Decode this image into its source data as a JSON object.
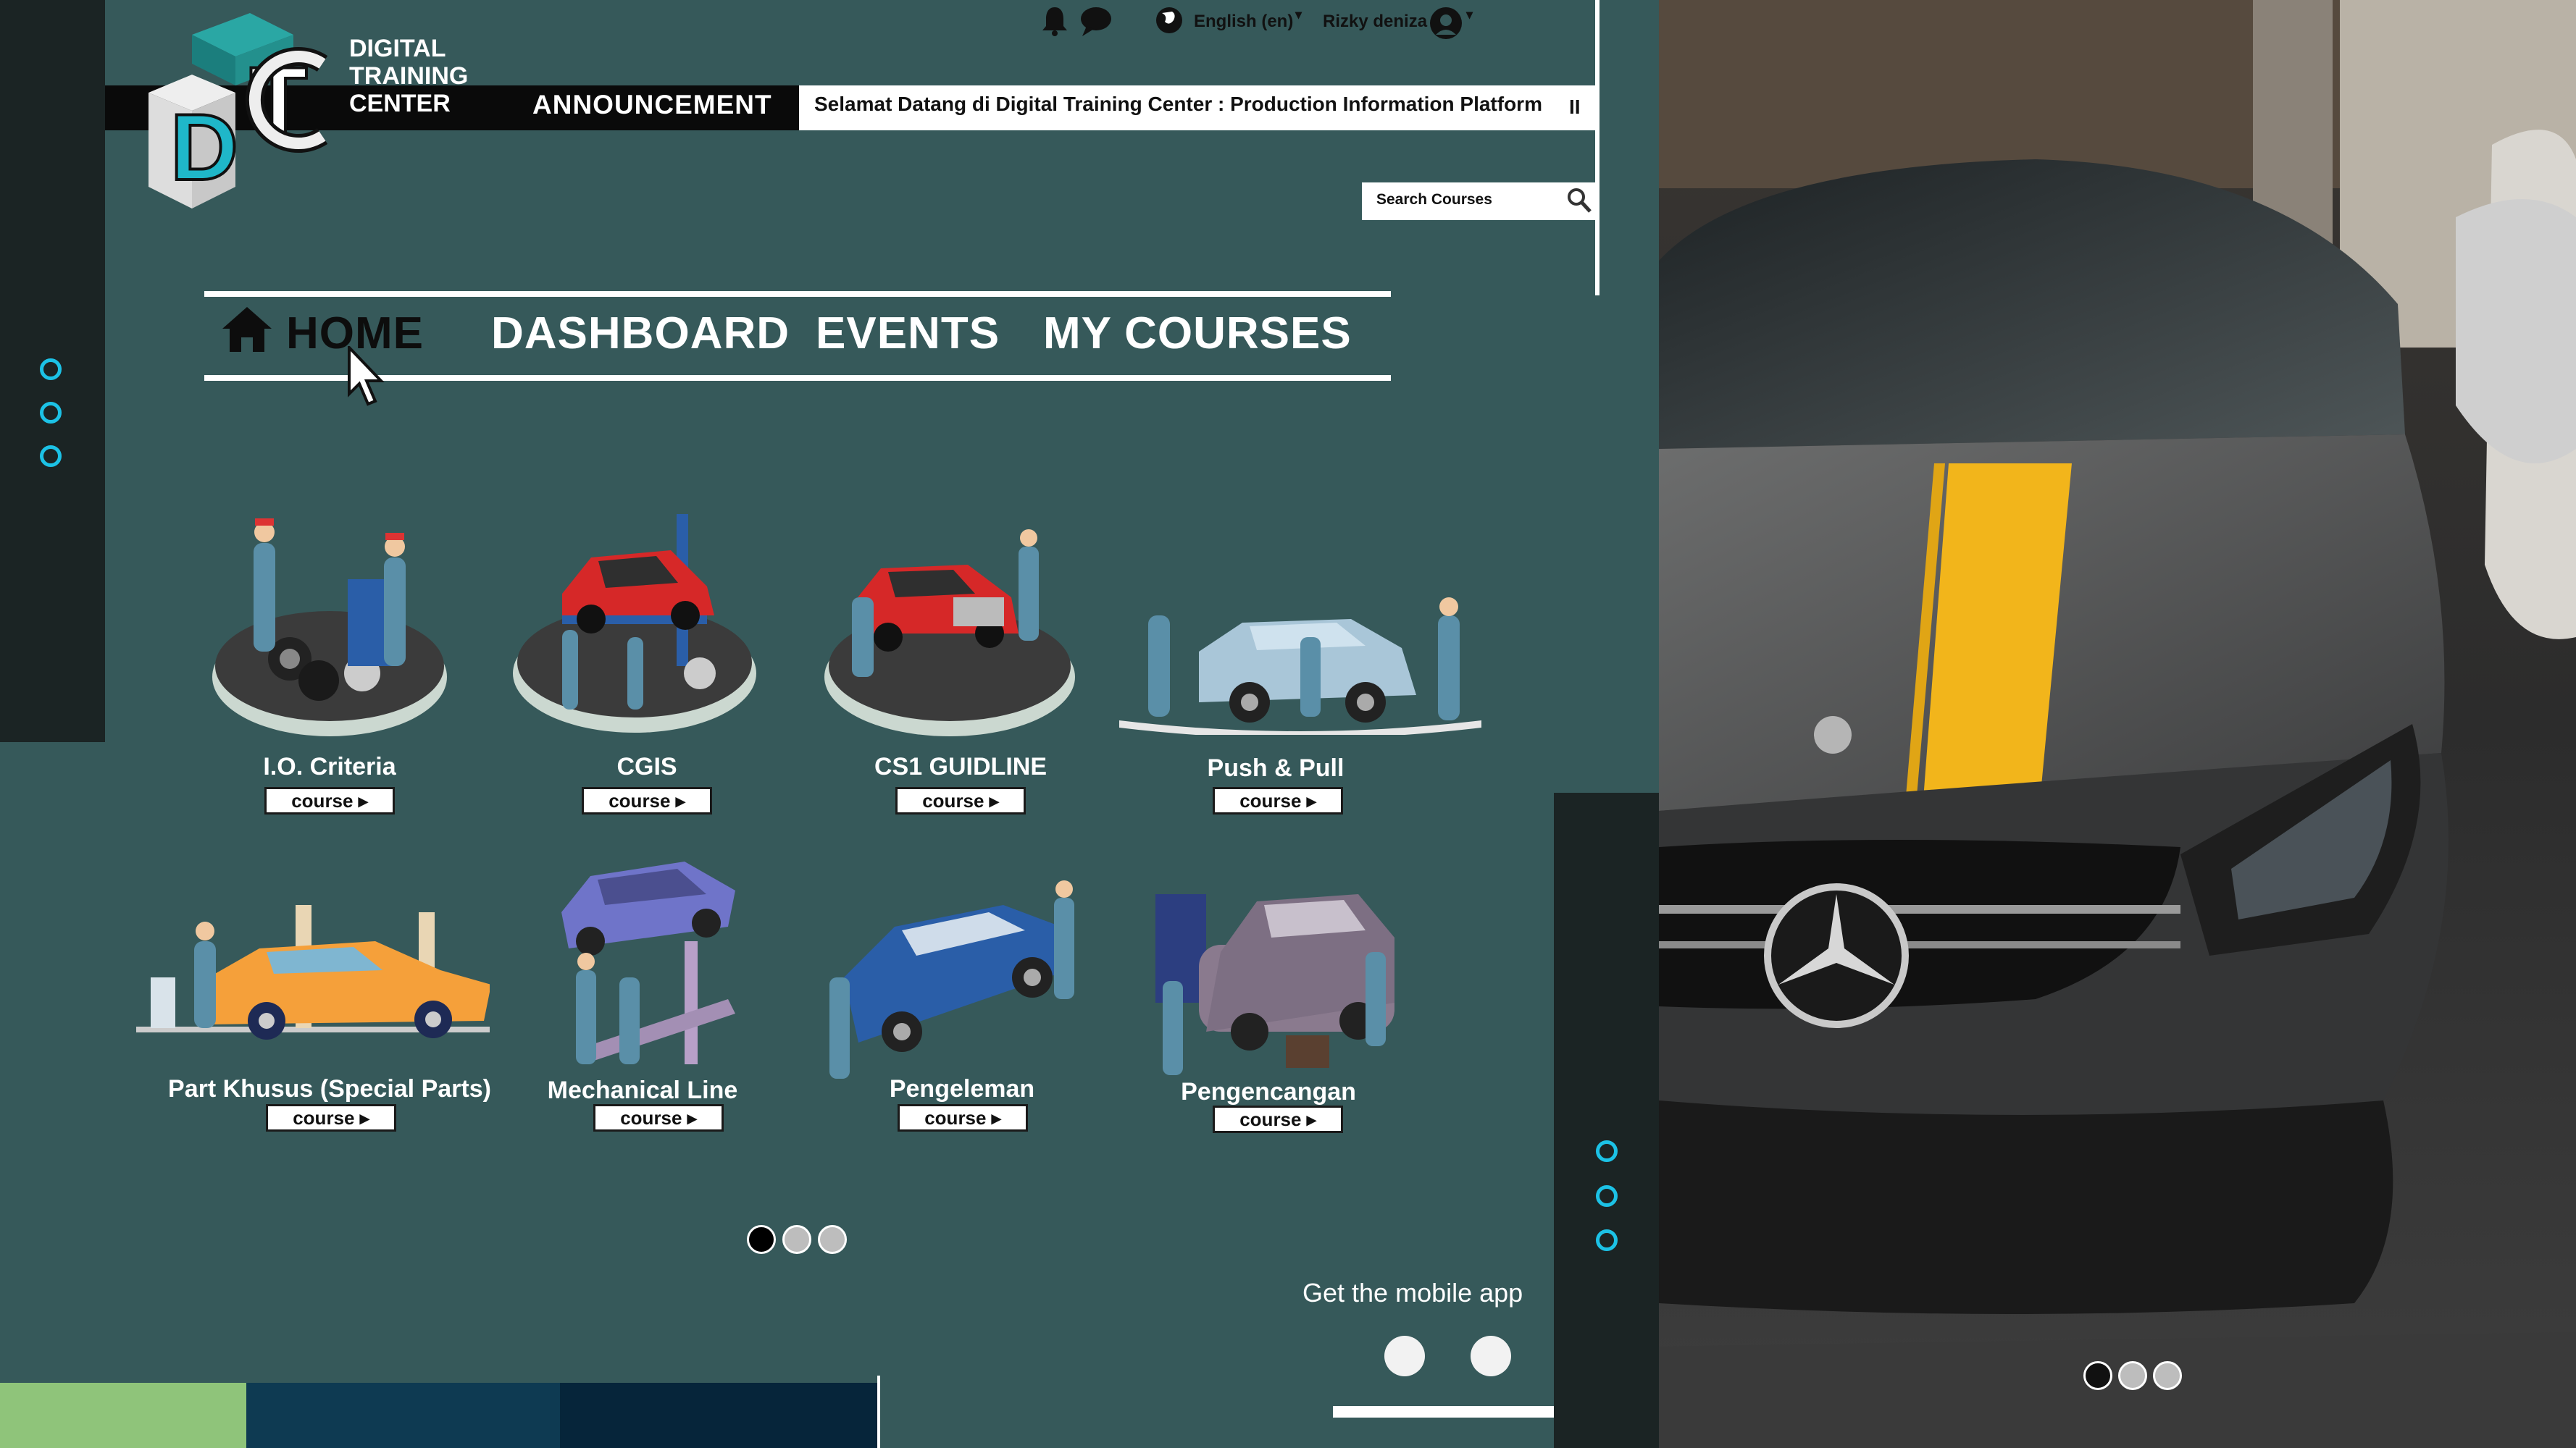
{
  "brand": {
    "line1": "DIGITAL",
    "line2": "TRAINING",
    "line3": "CENTER"
  },
  "header": {
    "language": "English (en)",
    "user_name": "Rizky deniza",
    "announcement_label": "ANNOUNCEMENT",
    "announcement_text": "Selamat Datang di Digital Training Center : Production Information Platform",
    "pause_symbol": "II"
  },
  "search": {
    "placeholder": "Search Courses"
  },
  "nav": {
    "home": "HOME",
    "dashboard": "DASHBOARD",
    "events": "EVENTS",
    "my_courses": "MY COURSES"
  },
  "courses": [
    {
      "title": "I.O. Criteria",
      "button": "course ▸"
    },
    {
      "title": "CGIS",
      "button": "course ▸"
    },
    {
      "title": "CS1 GUIDLINE",
      "button": "course ▸"
    },
    {
      "title": "Push & Pull",
      "button": "course ▸"
    },
    {
      "title": "Part Khusus (Special Parts)",
      "button": "course ▸"
    },
    {
      "title": "Mechanical Line",
      "button": "course ▸"
    },
    {
      "title": "Pengeleman",
      "button": "course ▸"
    },
    {
      "title": "Pengencangan",
      "button": "course ▸"
    }
  ],
  "footer": {
    "mobile_app": "Get the mobile app"
  },
  "colors": {
    "background": "#36595a",
    "accent": "#1cc2e6",
    "dark": "#1b2424"
  },
  "carousel": {
    "pages": 3,
    "active": 1
  }
}
